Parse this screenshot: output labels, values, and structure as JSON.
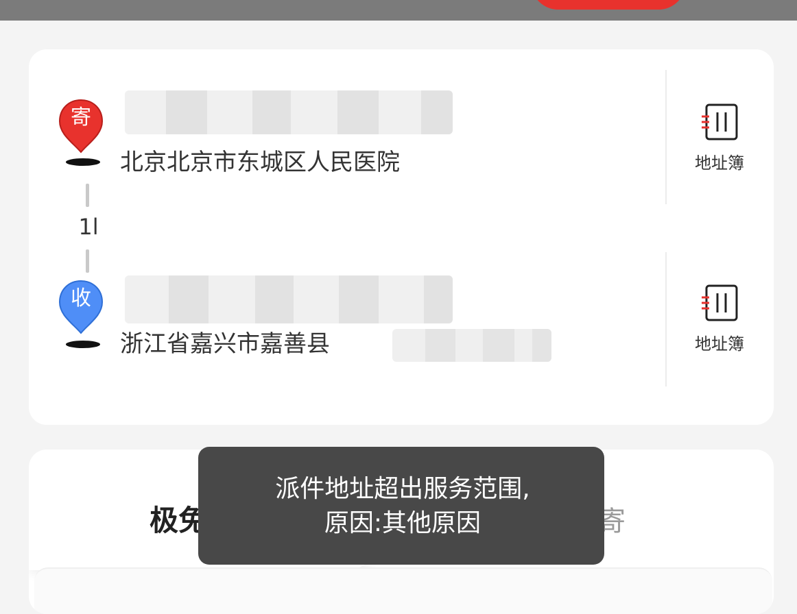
{
  "sender": {
    "badge": "寄",
    "address": "北京北京市东城区人民医院",
    "book_label": "地址簿",
    "badge_color": "#e8322d"
  },
  "distance": "1l",
  "receiver": {
    "badge": "收",
    "address": "浙江省嘉兴市嘉善县",
    "book_label": "地址簿",
    "badge_color": "#4f8ef7"
  },
  "service": {
    "left_tab": "极免",
    "right_tab": "自寄"
  },
  "toast": {
    "line1": "派件地址超出服务范围,",
    "line2": "原因:其他原因"
  }
}
